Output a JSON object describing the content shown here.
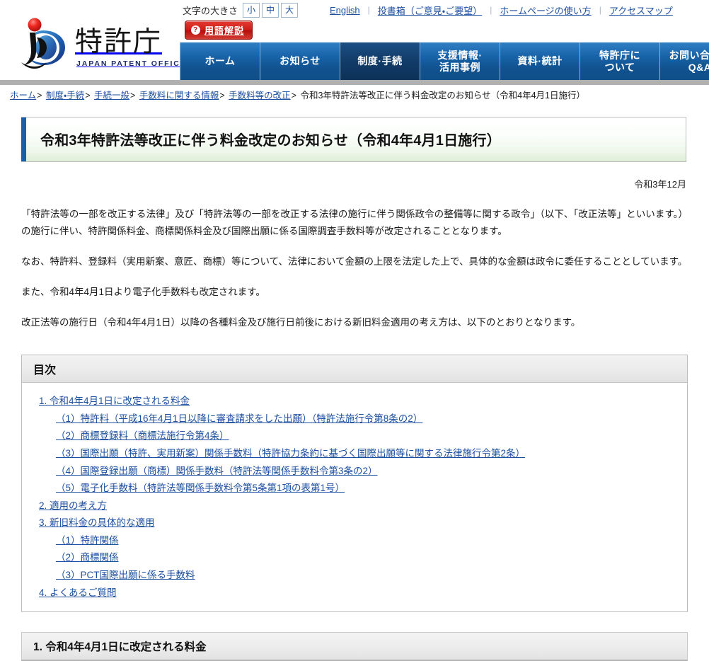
{
  "header": {
    "logo": {
      "jp_name": "特許庁",
      "en_name": "JAPAN PATENT OFFICE",
      "icon": "jpo-logo-icon"
    },
    "fontsize": {
      "label": "文字の大きさ",
      "options": [
        "小",
        "中",
        "大"
      ]
    },
    "glossary_button": {
      "label": "用語解説",
      "icon": "question-mark-icon"
    },
    "util_links": [
      "English",
      "投書箱（ご意見・ご要望）",
      "ホームページの使い方",
      "アクセスマップ"
    ],
    "nav": [
      {
        "label": "ホーム",
        "active": false
      },
      {
        "label": "お知らせ",
        "active": false
      },
      {
        "label": "制度·手続",
        "active": true
      },
      {
        "label": "支援情報·\n活用事例",
        "active": false
      },
      {
        "label": "資料·統計",
        "active": false
      },
      {
        "label": "特許庁に\nついて",
        "active": false
      },
      {
        "label": "お問い合わせ\nQ&A",
        "active": false
      }
    ]
  },
  "breadcrumb": {
    "links": [
      "ホーム",
      "制度・手続",
      "手続一般",
      "手数料に関する情報",
      "手数料等の改正"
    ],
    "separator": ">",
    "current": "令和3年特許法等改正に伴う料金改定のお知らせ（令和4年4月1日施行）"
  },
  "main": {
    "page_title": "令和3年特許法等改正に伴う料金改定のお知らせ（令和4年4月1日施行）",
    "date": "令和3年12月",
    "paragraphs": [
      "「特許法等の一部を改正する法律」及び「特許法等の一部を改正する法律の施行に伴う関係政令の整備等に関する政令」（以下、「改正法等」といいます。）の施行に伴い、特許関係料金、商標関係料金及び国際出願に係る国際調査手数料等が改定されることとなります。",
      "なお、特許料、登録料（実用新案、意匠、商標）等について、法律において金額の上限を法定した上で、具体的な金額は政令に委任することとしています。",
      "また、令和4年4月1日より電子化手数料も改定されます。",
      "改正法等の施行日（令和4年4月1日）以降の各種料金及び施行日前後における新旧料金適用の考え方は、以下のとおりとなります。"
    ],
    "toc": {
      "heading": "目次",
      "items": [
        {
          "level": 1,
          "text": "1. 令和4年4月1日に改定される料金"
        },
        {
          "level": 2,
          "text": "（1）特許料（平成16年4月1日以降に審査請求をした出願）（特許法施行令第8条の2）"
        },
        {
          "level": 2,
          "text": "（2）商標登録料（商標法施行令第4条）"
        },
        {
          "level": 2,
          "text": "（3）国際出願（特許、実用新案）関係手数料（特許協力条約に基づく国際出願等に関する法律施行令第2条）"
        },
        {
          "level": 2,
          "text": "（4）国際登録出願（商標）関係手数料（特許法等関係手数料令第3条の2）"
        },
        {
          "level": 2,
          "text": "（5）電子化手数料（特許法等関係手数料令第5条第1項の表第1号）"
        },
        {
          "level": 1,
          "text": "2. 適用の考え方"
        },
        {
          "level": 1,
          "text": "3. 新旧料金の具体的な適用"
        },
        {
          "level": 2,
          "text": "（1）特許関係"
        },
        {
          "level": 2,
          "text": "（2）商標関係"
        },
        {
          "level": 2,
          "text": "（3）PCT国際出願に係る手数料"
        },
        {
          "level": 1,
          "text": "4. よくあるご質問"
        }
      ]
    },
    "section_heading": "1. 令和4年4月1日に改定される料金"
  },
  "colors": {
    "nav_blue": "#1862a8",
    "nav_active_blue": "#123d6b",
    "link_blue": "#1d4fa0",
    "glossary_red": "#cf1d16",
    "title_bar_blue": "#1c5fa8",
    "divider_gray": "#b0b0b0"
  }
}
